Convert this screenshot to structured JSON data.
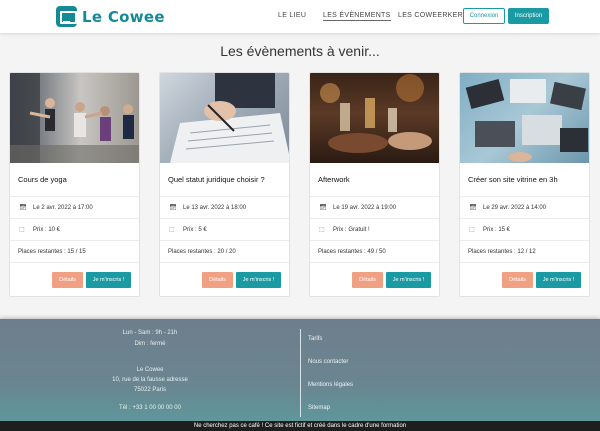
{
  "nav": {
    "logo_text": "Le Cowee",
    "links": [
      "LE LIEU",
      "LES ÉVÈNEMENTS",
      "LES COWEERKERS"
    ],
    "login_label": "Connexion",
    "signup_label": "Inscription"
  },
  "page_title": "Les évènements à venir...",
  "events": [
    {
      "title": "Cours de yoga",
      "date": "Le 2 avr. 2022 à 17:00",
      "price": "Prix : 10 €",
      "places": "Places restantes : 15 / 15",
      "details_label": "Détails",
      "signup_label": "Je m'inscris !"
    },
    {
      "title": "Quel statut juridique choisir ?",
      "date": "Le 13 avr. 2022 à 18:00",
      "price": "Prix : 5 €",
      "places": "Places restantes : 20 / 20",
      "details_label": "Détails",
      "signup_label": "Je m'inscris !"
    },
    {
      "title": "Afterwork",
      "date": "Le 19 avr. 2022 à 19:00",
      "price": "Prix : Gratuit !",
      "places": "Places restantes : 49 / 50",
      "details_label": "Détails",
      "signup_label": "Je m'inscris !"
    },
    {
      "title": "Créer son site vitrine en 3h",
      "date": "Le 29 avr. 2022 à 14:00",
      "price": "Prix : 15 €",
      "places": "Places restantes : 12 / 12",
      "details_label": "Détails",
      "signup_label": "Je m'inscris !"
    }
  ],
  "footer": {
    "hours_1": "Lun - Sam : 9h - 21h",
    "hours_2": "Dim : fermé",
    "name": "Le Cowee",
    "address_1": "10, rue de la fausse adresse",
    "address_2": "75022 Paris",
    "phone": "Tél : +33 1 00 00 00 00",
    "links": [
      "Tarifs",
      "Nous contacter",
      "Mentions légales",
      "Sitemap"
    ]
  },
  "disclaimer": "Ne cherchez pas ce café ! Ce site est fictif et créé dans le cadre d'une formation",
  "colors": {
    "accent": "#1a9aa3",
    "details": "#f0a083"
  },
  "icons": {
    "date": "calendar-icon",
    "price": "money-icon"
  }
}
